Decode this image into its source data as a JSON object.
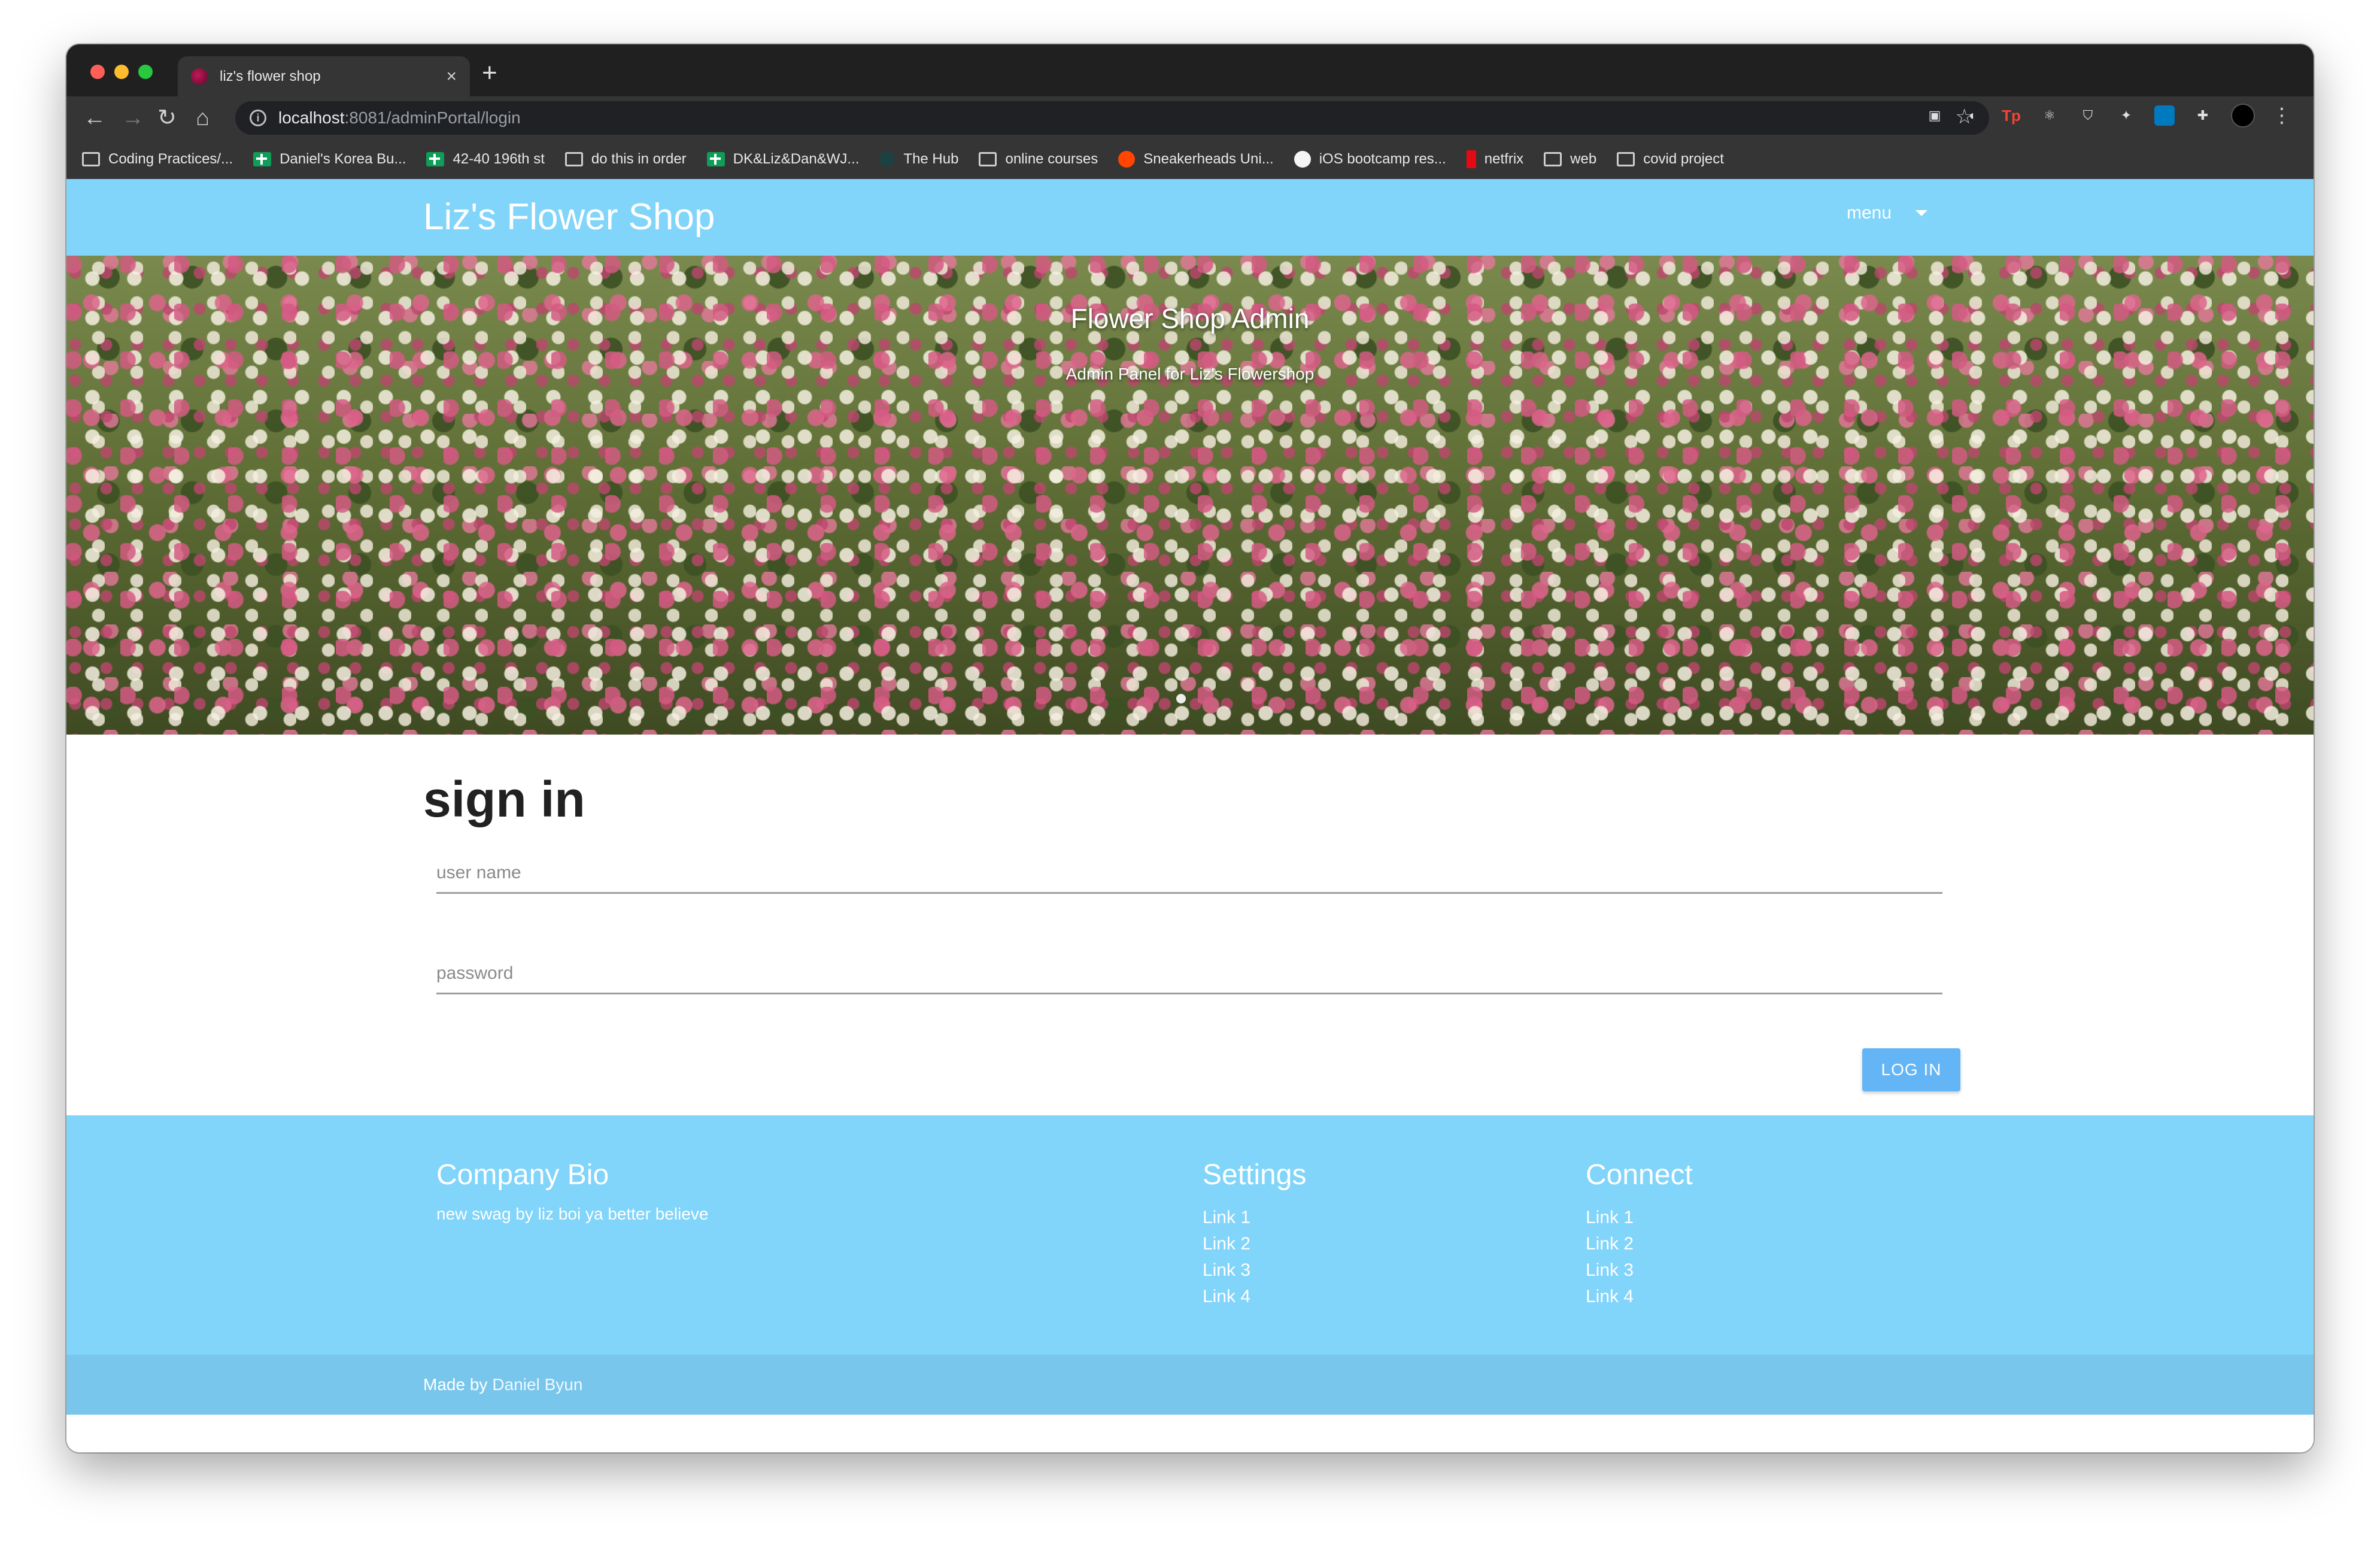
{
  "browser": {
    "tab_title": "liz's flower shop",
    "tab_close": "×",
    "new_tab": "+",
    "url_host": "localhost",
    "url_rest": ":8081/adminPortal/login",
    "nav": {
      "back": "←",
      "forward": "→",
      "reload": "↻",
      "home": "⌂"
    },
    "star": "☆",
    "bookmarks": [
      {
        "label": "Coding Practices/...",
        "icon": "folder-icon"
      },
      {
        "label": "Daniel's Korea Bu...",
        "icon": "sheets-icon"
      },
      {
        "label": "42-40 196th st",
        "icon": "sheets-icon"
      },
      {
        "label": "do this in order",
        "icon": "folder-icon"
      },
      {
        "label": "DK&Liz&Dan&WJ...",
        "icon": "sheets-icon"
      },
      {
        "label": "The Hub",
        "icon": "hub-icon"
      },
      {
        "label": "online courses",
        "icon": "folder-icon"
      },
      {
        "label": "Sneakerheads Uni...",
        "icon": "reddit-icon"
      },
      {
        "label": "iOS bootcamp res...",
        "icon": "ios-icon"
      },
      {
        "label": "netfrix",
        "icon": "netflix-icon"
      },
      {
        "label": "web",
        "icon": "folder-icon"
      },
      {
        "label": "covid project",
        "icon": "folder-icon"
      }
    ]
  },
  "navbar": {
    "brand": "Liz's Flower Shop",
    "menu_label": "menu"
  },
  "hero": {
    "title": "Flower Shop Admin",
    "subtitle": "Admin Panel for Liz's Flowershop"
  },
  "signin": {
    "heading": "sign in",
    "username_placeholder": "user name",
    "password_placeholder": "password",
    "login_label": "LOG IN"
  },
  "footer": {
    "bio_heading": "Company Bio",
    "bio_text": "new swag by liz boi ya better believe",
    "settings_heading": "Settings",
    "settings_links": [
      "Link 1",
      "Link 2",
      "Link 3",
      "Link 4"
    ],
    "connect_heading": "Connect",
    "connect_links": [
      "Link 1",
      "Link 2",
      "Link 3",
      "Link 4"
    ],
    "made_by": "Made by",
    "author": "Daniel Byun"
  },
  "colors": {
    "brand_blue": "#81d4fa",
    "button_blue": "#64b5f6",
    "footer_bottom": "#79c6ec"
  }
}
